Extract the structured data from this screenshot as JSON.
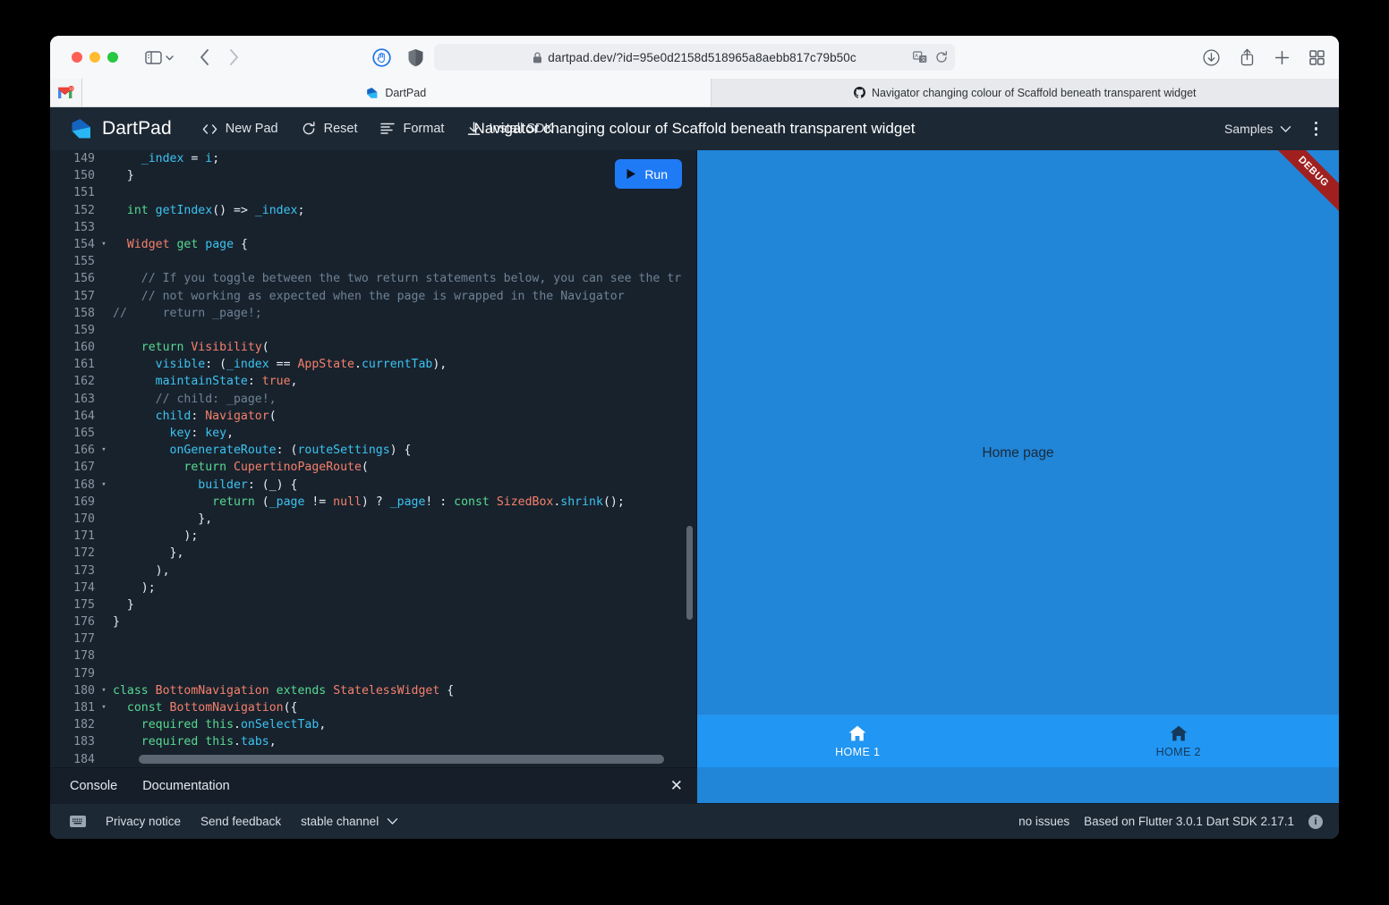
{
  "browser": {
    "url": "dartpad.dev/?id=95e0d2158d518965a8aebb817c79b50c",
    "lock_icon": "lock-icon",
    "reader_icon": "reader-view-icon",
    "reload_icon": "reload-icon",
    "sidebar_icon": "sidebar-toggle-icon",
    "back_icon": "back-arrow-icon",
    "forward_icon": "forward-arrow-icon",
    "extension_icons": [
      "hand-extension-icon",
      "shield-extension-icon"
    ],
    "right_icons": [
      "downloads-icon",
      "share-icon",
      "new-tab-icon",
      "tab-overview-icon"
    ],
    "tabs": [
      {
        "label": "",
        "icon": "gmail-favicon",
        "badge": "10",
        "state": "pinned"
      },
      {
        "label": "DartPad",
        "icon": "dartpad-favicon",
        "state": "active"
      },
      {
        "label": "Navigator changing colour of Scaffold beneath transparent widget",
        "icon": "github-favicon",
        "state": "inactive"
      }
    ]
  },
  "dartpad": {
    "brand": "DartPad",
    "brand_icon": "dartpad-logo-icon",
    "actions": [
      {
        "label": "New Pad",
        "icon": "code-brackets-icon"
      },
      {
        "label": "Reset",
        "icon": "refresh-icon"
      },
      {
        "label": "Format",
        "icon": "format-lines-icon"
      },
      {
        "label": "Install SDK",
        "icon": "download-icon"
      }
    ],
    "title": "Navigator changing colour of Scaffold beneath transparent widget",
    "samples_label": "Samples",
    "samples_chevron": "chevron-down-icon",
    "more_menu_icon": "kebab-menu-icon",
    "run_label": "Run",
    "run_icon": "play-icon",
    "accent_color": "#1f7bf5"
  },
  "console": {
    "tabs": [
      "Console",
      "Documentation"
    ],
    "close_icon": "close-icon"
  },
  "status": {
    "keyboard_icon": "keyboard-icon",
    "privacy": "Privacy notice",
    "feedback": "Send feedback",
    "channel": "stable channel",
    "channel_chevron": "chevron-down-icon",
    "issues": "no issues",
    "version": "Based on Flutter 3.0.1 Dart SDK 2.17.1",
    "info_icon": "info-icon"
  },
  "preview": {
    "debug_banner": "DEBUG",
    "page_text": "Home page",
    "background_color": "#2185d8",
    "nav_background": "#2196f3",
    "nav_items": [
      {
        "label": "HOME 1",
        "icon": "home-icon",
        "active": true
      },
      {
        "label": "HOME 2",
        "icon": "home-icon",
        "active": false
      }
    ]
  },
  "editor": {
    "first_line": 149,
    "lines": [
      {
        "n": 149,
        "fold": "",
        "tokens": [
          [
            "plain",
            "    "
          ],
          [
            "field",
            "_index"
          ],
          [
            "plain",
            " = "
          ],
          [
            "field",
            "i"
          ],
          [
            "plain",
            ";"
          ]
        ]
      },
      {
        "n": 150,
        "fold": "",
        "tokens": [
          [
            "plain",
            "  }"
          ]
        ]
      },
      {
        "n": 151,
        "fold": "",
        "tokens": []
      },
      {
        "n": 152,
        "fold": "",
        "tokens": [
          [
            "plain",
            "  "
          ],
          [
            "key",
            "int"
          ],
          [
            "plain",
            " "
          ],
          [
            "field",
            "getIndex"
          ],
          [
            "plain",
            "() => "
          ],
          [
            "field",
            "_index"
          ],
          [
            "plain",
            ";"
          ]
        ]
      },
      {
        "n": 153,
        "fold": "",
        "tokens": []
      },
      {
        "n": 154,
        "fold": "▾",
        "tokens": [
          [
            "plain",
            "  "
          ],
          [
            "type",
            "Widget"
          ],
          [
            "plain",
            " "
          ],
          [
            "key",
            "get"
          ],
          [
            "plain",
            " "
          ],
          [
            "field",
            "page"
          ],
          [
            "plain",
            " {"
          ]
        ]
      },
      {
        "n": 155,
        "fold": "",
        "tokens": []
      },
      {
        "n": 156,
        "fold": "",
        "tokens": [
          [
            "com",
            "    // If you toggle between the two return statements below, you can see the tr"
          ]
        ]
      },
      {
        "n": 157,
        "fold": "",
        "tokens": [
          [
            "com",
            "    // not working as expected when the page is wrapped in the Navigator"
          ]
        ]
      },
      {
        "n": 158,
        "fold": "",
        "tokens": [
          [
            "com",
            "//     return _page!;"
          ]
        ]
      },
      {
        "n": 159,
        "fold": "",
        "tokens": []
      },
      {
        "n": 160,
        "fold": "",
        "tokens": [
          [
            "plain",
            "    "
          ],
          [
            "key",
            "return"
          ],
          [
            "plain",
            " "
          ],
          [
            "type",
            "Visibility"
          ],
          [
            "plain",
            "("
          ]
        ]
      },
      {
        "n": 161,
        "fold": "",
        "tokens": [
          [
            "plain",
            "      "
          ],
          [
            "field",
            "visible"
          ],
          [
            "plain",
            ": ("
          ],
          [
            "field",
            "_index"
          ],
          [
            "plain",
            " == "
          ],
          [
            "type",
            "AppState"
          ],
          [
            "plain",
            "."
          ],
          [
            "field",
            "currentTab"
          ],
          [
            "plain",
            "),"
          ]
        ]
      },
      {
        "n": 162,
        "fold": "",
        "tokens": [
          [
            "plain",
            "      "
          ],
          [
            "field",
            "maintainState"
          ],
          [
            "plain",
            ": "
          ],
          [
            "type",
            "true"
          ],
          [
            "plain",
            ","
          ]
        ]
      },
      {
        "n": 163,
        "fold": "",
        "tokens": [
          [
            "plain",
            "      "
          ],
          [
            "com",
            "// child: _page!,"
          ]
        ]
      },
      {
        "n": 164,
        "fold": "",
        "tokens": [
          [
            "plain",
            "      "
          ],
          [
            "field",
            "child"
          ],
          [
            "plain",
            ": "
          ],
          [
            "type",
            "Navigator"
          ],
          [
            "plain",
            "("
          ]
        ]
      },
      {
        "n": 165,
        "fold": "",
        "tokens": [
          [
            "plain",
            "        "
          ],
          [
            "field",
            "key"
          ],
          [
            "plain",
            ": "
          ],
          [
            "field",
            "key"
          ],
          [
            "plain",
            ","
          ]
        ]
      },
      {
        "n": 166,
        "fold": "▾",
        "tokens": [
          [
            "plain",
            "        "
          ],
          [
            "field",
            "onGenerateRoute"
          ],
          [
            "plain",
            ": ("
          ],
          [
            "field",
            "routeSettings"
          ],
          [
            "plain",
            ") {"
          ]
        ]
      },
      {
        "n": 167,
        "fold": "",
        "tokens": [
          [
            "plain",
            "          "
          ],
          [
            "key",
            "return"
          ],
          [
            "plain",
            " "
          ],
          [
            "type",
            "CupertinoPageRoute"
          ],
          [
            "plain",
            "("
          ]
        ]
      },
      {
        "n": 168,
        "fold": "▾",
        "tokens": [
          [
            "plain",
            "            "
          ],
          [
            "field",
            "builder"
          ],
          [
            "plain",
            ": ("
          ],
          [
            "plain",
            "_"
          ],
          [
            "plain",
            ") {"
          ]
        ]
      },
      {
        "n": 169,
        "fold": "",
        "tokens": [
          [
            "plain",
            "              "
          ],
          [
            "key",
            "return"
          ],
          [
            "plain",
            " ("
          ],
          [
            "field",
            "_page"
          ],
          [
            "plain",
            " != "
          ],
          [
            "type",
            "null"
          ],
          [
            "plain",
            ") ? "
          ],
          [
            "field",
            "_page"
          ],
          [
            "plain",
            "! : "
          ],
          [
            "key",
            "const"
          ],
          [
            "plain",
            " "
          ],
          [
            "type",
            "SizedBox"
          ],
          [
            "plain",
            "."
          ],
          [
            "field",
            "shrink"
          ],
          [
            "plain",
            "();"
          ]
        ]
      },
      {
        "n": 170,
        "fold": "",
        "tokens": [
          [
            "plain",
            "            },"
          ]
        ]
      },
      {
        "n": 171,
        "fold": "",
        "tokens": [
          [
            "plain",
            "          );"
          ]
        ]
      },
      {
        "n": 172,
        "fold": "",
        "tokens": [
          [
            "plain",
            "        },"
          ]
        ]
      },
      {
        "n": 173,
        "fold": "",
        "tokens": [
          [
            "plain",
            "      ),"
          ]
        ]
      },
      {
        "n": 174,
        "fold": "",
        "tokens": [
          [
            "plain",
            "    );"
          ]
        ]
      },
      {
        "n": 175,
        "fold": "",
        "tokens": [
          [
            "plain",
            "  }"
          ]
        ]
      },
      {
        "n": 176,
        "fold": "",
        "tokens": [
          [
            "plain",
            "}"
          ]
        ]
      },
      {
        "n": 177,
        "fold": "",
        "tokens": []
      },
      {
        "n": 178,
        "fold": "",
        "tokens": []
      },
      {
        "n": 179,
        "fold": "",
        "tokens": []
      },
      {
        "n": 180,
        "fold": "▾",
        "tokens": [
          [
            "key",
            "class"
          ],
          [
            "plain",
            " "
          ],
          [
            "type",
            "BottomNavigation"
          ],
          [
            "plain",
            " "
          ],
          [
            "key",
            "extends"
          ],
          [
            "plain",
            " "
          ],
          [
            "type",
            "StatelessWidget"
          ],
          [
            "plain",
            " {"
          ]
        ]
      },
      {
        "n": 181,
        "fold": "▾",
        "tokens": [
          [
            "plain",
            "  "
          ],
          [
            "key",
            "const"
          ],
          [
            "plain",
            " "
          ],
          [
            "type",
            "BottomNavigation"
          ],
          [
            "plain",
            "({"
          ]
        ]
      },
      {
        "n": 182,
        "fold": "",
        "tokens": [
          [
            "plain",
            "    "
          ],
          [
            "key",
            "required"
          ],
          [
            "plain",
            " "
          ],
          [
            "key",
            "this"
          ],
          [
            "plain",
            "."
          ],
          [
            "field",
            "onSelectTab"
          ],
          [
            "plain",
            ","
          ]
        ]
      },
      {
        "n": 183,
        "fold": "",
        "tokens": [
          [
            "plain",
            "    "
          ],
          [
            "key",
            "required"
          ],
          [
            "plain",
            " "
          ],
          [
            "key",
            "this"
          ],
          [
            "plain",
            "."
          ],
          [
            "field",
            "tabs"
          ],
          [
            "plain",
            ","
          ]
        ]
      },
      {
        "n": 184,
        "fold": "",
        "tokens": []
      }
    ]
  }
}
